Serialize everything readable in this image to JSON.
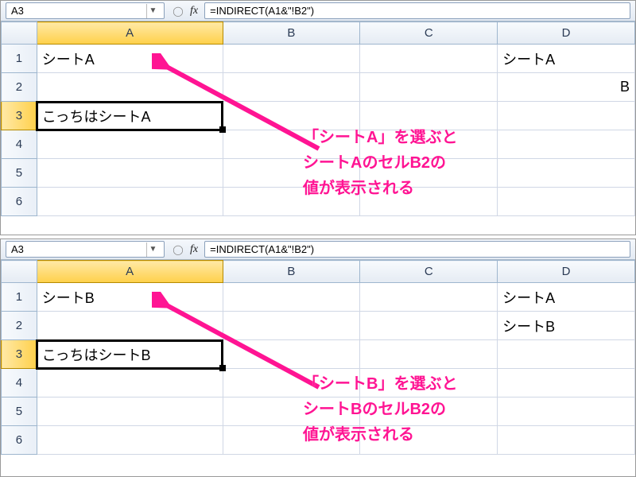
{
  "top": {
    "nameBox": "A3",
    "formula": "=INDIRECT(A1&\"!B2\")",
    "fxLabel": "fx",
    "cols": [
      "A",
      "B",
      "C",
      "D"
    ],
    "rows": [
      "1",
      "2",
      "3",
      "4",
      "5",
      "6"
    ],
    "cells": {
      "A1": "シートA",
      "A3": "こっちはシートA",
      "D1": "シートA",
      "D2_suffix": "B"
    },
    "annotation": "「シートA」を選ぶと\nシートAのセルB2の\n値が表示される"
  },
  "bottom": {
    "nameBox": "A3",
    "formula": "=INDIRECT(A1&\"!B2\")",
    "fxLabel": "fx",
    "cols": [
      "A",
      "B",
      "C",
      "D"
    ],
    "rows": [
      "1",
      "2",
      "3",
      "4",
      "5",
      "6"
    ],
    "cells": {
      "A1": "シートB",
      "A3": "こっちはシートB",
      "D1": "シートA",
      "D2": "シートB"
    },
    "annotation": "「シートB」を選ぶと\nシートBのセルB2の\n値が表示される"
  }
}
